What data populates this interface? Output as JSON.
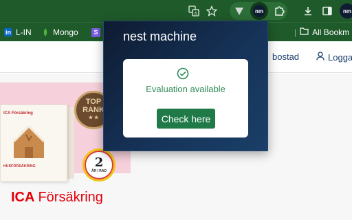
{
  "browser": {
    "toolbar_icons": [
      "translate-icon",
      "star-icon",
      "vpn-extension-icon",
      "nest-machine-icon",
      "extensions-puzzle-icon",
      "download-icon",
      "side-panel-icon"
    ],
    "profile_label": "nm",
    "colors": {
      "toolbar": "#1f5a2a",
      "pill": "#2c6e38"
    }
  },
  "bookmarks": {
    "items": [
      {
        "label": "L-IN",
        "icon": "linkedin-icon"
      },
      {
        "label": "Mongo",
        "icon": "mongo-leaf-icon"
      },
      {
        "label": "",
        "icon": "s-logo-icon",
        "icon_text": "S"
      }
    ],
    "all_bookmarks_label": "All Bookm"
  },
  "site": {
    "nav": {
      "housing_label": "bostad",
      "login_label": "Logga"
    },
    "promo": {
      "box_brand": "ICA Försäkring",
      "box_title": "HUSFÖRSÄKRING",
      "gold_badge_lines": [
        "TOP",
        "RANK"
      ],
      "round_badge_number": "2",
      "round_badge_text": "ÅR I RAD"
    },
    "logo": {
      "mark": "ICA",
      "text": "Försäkring"
    },
    "colors": {
      "brand_red": "#e3000b",
      "pink": "#f6d0da"
    }
  },
  "popup": {
    "title": "nest machine",
    "status_text": "Evaluation available",
    "button_label": "Check here",
    "colors": {
      "background": "#0e1b31",
      "success": "#2e8b57",
      "button": "#1f7a48"
    }
  }
}
